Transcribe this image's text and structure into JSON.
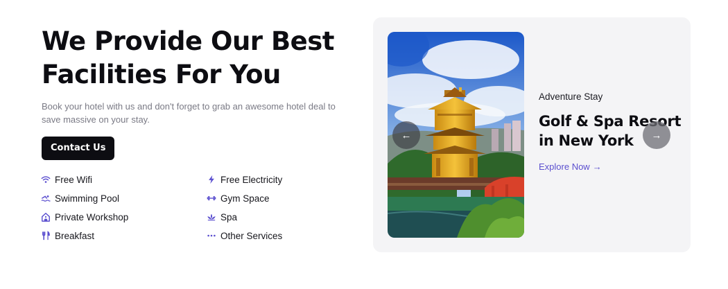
{
  "hero": {
    "title_line1": "We Provide Our Best",
    "title_line2": "Facilities For You",
    "subtitle": "Book your hotel with us and don't forget to grab an awesome hotel deal to save massive on your stay.",
    "cta_label": "Contact Us"
  },
  "facilities": [
    {
      "label": "Free Wifi",
      "icon": "wifi-icon"
    },
    {
      "label": "Free Electricity",
      "icon": "lightning-icon"
    },
    {
      "label": "Swimming Pool",
      "icon": "swimmer-icon"
    },
    {
      "label": "Gym Space",
      "icon": "dumbbell-icon"
    },
    {
      "label": "Private Workshop",
      "icon": "workshop-house-icon"
    },
    {
      "label": "Spa",
      "icon": "lotus-icon"
    },
    {
      "label": "Breakfast",
      "icon": "cutlery-icon"
    },
    {
      "label": "Other Services",
      "icon": "dots-icon"
    }
  ],
  "slider": {
    "eyebrow": "Adventure Stay",
    "title_line1": "Golf & Spa Resort",
    "title_line2": "in New York",
    "link_label": "Explore Now",
    "prev_glyph": "←",
    "next_glyph": "→",
    "link_arrow": "→"
  },
  "colors": {
    "accent": "#5b4fcf",
    "dark": "#0d0d12",
    "card_bg": "#f4f4f6"
  }
}
